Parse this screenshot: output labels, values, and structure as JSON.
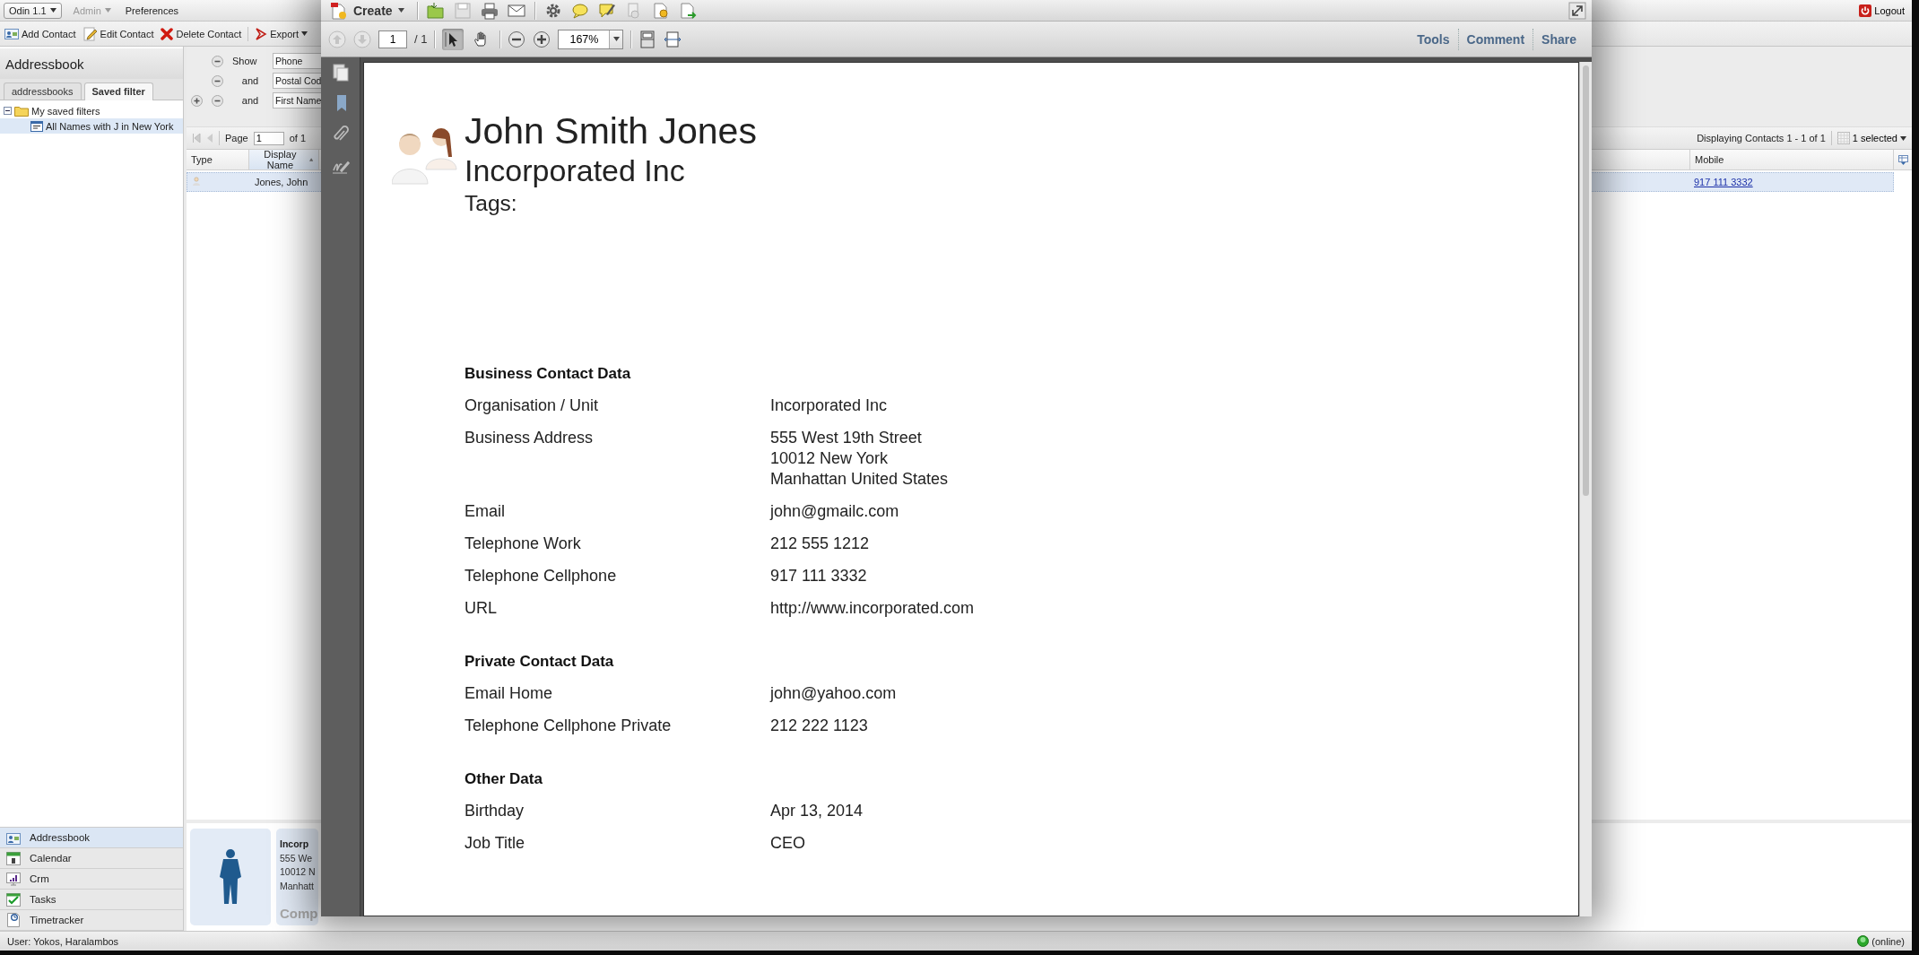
{
  "app": {
    "menu": [
      {
        "label": "Odin 1.1",
        "kind": "boxed-dropdown",
        "disabled": false
      },
      {
        "label": "Admin",
        "kind": "dropdown",
        "disabled": true
      },
      {
        "label": "Preferences",
        "kind": "plain",
        "disabled": false
      }
    ],
    "logout": "Logout",
    "toolbar": [
      {
        "label": "Add Contact",
        "kind": "add"
      },
      {
        "label": "Edit Contact",
        "kind": "edit"
      },
      {
        "label": "Delete Contact",
        "kind": "delete"
      },
      {
        "label": "Export",
        "kind": "export"
      }
    ],
    "sidebar": {
      "title": "Addressbook",
      "tabs": [
        {
          "label": "addressbooks",
          "selected": false
        },
        {
          "label": "Saved filter",
          "selected": true
        }
      ],
      "tree": [
        {
          "label": "My saved filters",
          "expanded": true,
          "selected": false,
          "children": [
            {
              "label": "All Names with J in New York",
              "selected": true
            }
          ]
        }
      ]
    },
    "modules": [
      {
        "label": "Addressbook",
        "kind": "addressbook",
        "selected": true
      },
      {
        "label": "Calendar",
        "kind": "calendar",
        "selected": false
      },
      {
        "label": "Crm",
        "kind": "crm",
        "selected": false
      },
      {
        "label": "Tasks",
        "kind": "tasks",
        "selected": false
      },
      {
        "label": "Timetracker",
        "kind": "timetracker",
        "selected": false
      }
    ],
    "filters": [
      {
        "operator": "Show",
        "field": "Phone",
        "can_add": false
      },
      {
        "operator": "and",
        "field": "Postal Cod",
        "can_add": false
      },
      {
        "operator": "and",
        "field": "First Name",
        "can_add": true
      }
    ],
    "pager": {
      "page_label": "Page",
      "page": "1",
      "of": "of 1",
      "display": "Displaying Contacts 1 - 1 of 1",
      "selection": "1 selected"
    },
    "grid": {
      "columns": [
        {
          "label": "Type",
          "sorted": false
        },
        {
          "label": "Display Name",
          "sorted": true
        },
        {
          "label": "Mobile",
          "sorted": false
        }
      ],
      "rows": [
        {
          "display_name": "Jones, John",
          "mobile": "917 111 3332",
          "selected": true
        }
      ]
    },
    "details": {
      "lines": [
        "Incorp",
        "555 We",
        "10012 N",
        "Manhatt"
      ],
      "footer": "Comp"
    },
    "status_bar": {
      "user": "User: Yokos, Haralambos",
      "connection": "(online)"
    }
  },
  "pdf_viewer": {
    "create": "Create",
    "page": "1",
    "page_total": "/ 1",
    "nav_tools": [
      {
        "kind": "select",
        "selected": true
      },
      {
        "kind": "hand",
        "selected": false
      }
    ],
    "zoom": "167%",
    "panels": [
      "Tools",
      "Comment",
      "Share"
    ],
    "document": {
      "title": "John Smith Jones",
      "subtitle": "Incorporated Inc",
      "tags_label": "Tags:",
      "sections": [
        {
          "heading": "Business Contact Data",
          "rows": [
            {
              "label": "Organisation / Unit",
              "value": [
                "Incorporated Inc"
              ]
            },
            {
              "label": "Business Address",
              "value": [
                "555 West 19th Street",
                "10012 New York",
                "Manhattan United States"
              ]
            },
            {
              "label": "Email",
              "value": [
                "john@gmailc.com"
              ]
            },
            {
              "label": "Telephone Work",
              "value": [
                "212 555 1212"
              ]
            },
            {
              "label": "Telephone Cellphone",
              "value": [
                "917 111 3332"
              ]
            },
            {
              "label": "URL",
              "value": [
                "http://www.incorporated.com"
              ]
            }
          ]
        },
        {
          "heading": "Private Contact Data",
          "rows": [
            {
              "label": "Email Home",
              "value": [
                "john@yahoo.com"
              ]
            },
            {
              "label": "Telephone Cellphone Private",
              "value": [
                "212 222 1123"
              ]
            }
          ]
        },
        {
          "heading": "Other Data",
          "rows": [
            {
              "label": "Birthday",
              "value": [
                "Apr 13, 2014"
              ]
            },
            {
              "label": "Job Title",
              "value": [
                "CEO"
              ]
            }
          ]
        }
      ]
    }
  }
}
